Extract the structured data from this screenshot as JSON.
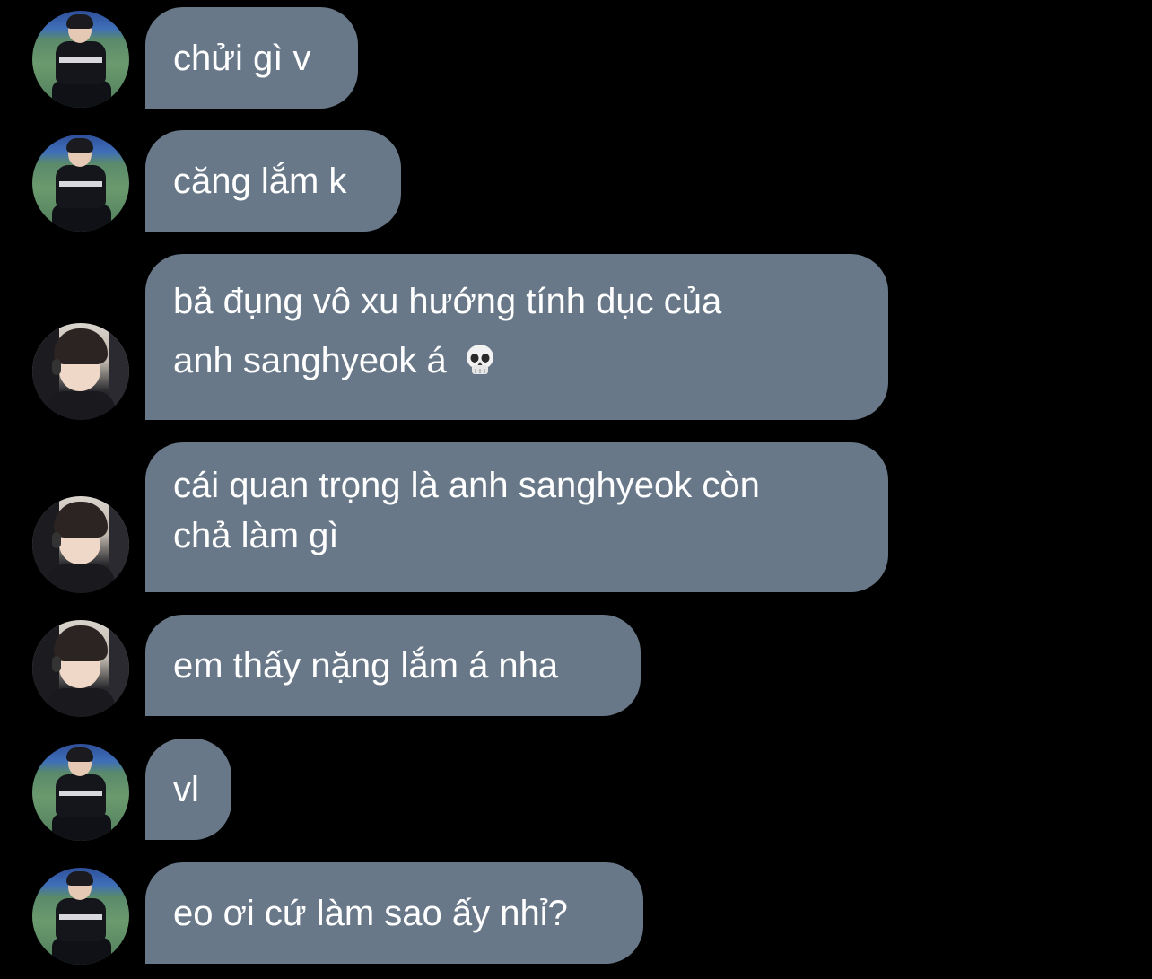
{
  "messages": [
    {
      "text": "chửi gì v",
      "avatar": "court-avatar"
    },
    {
      "text": "căng lắm k",
      "avatar": "court-avatar"
    },
    {
      "line1": "bả đụng vô xu hướng tính dục của",
      "line2": "anh sanghyeok á",
      "emoji": "skull-emoji",
      "avatar": "chair-avatar"
    },
    {
      "line1": "cái quan trọng là anh sanghyeok còn",
      "line2": "chả làm gì",
      "avatar": "chair-avatar"
    },
    {
      "text": "em thấy nặng lắm á nha",
      "avatar": "chair-avatar"
    },
    {
      "text": "vl",
      "avatar": "court-avatar"
    },
    {
      "text": "eo ơi cứ làm sao ấy nhỉ?",
      "avatar": "court-avatar"
    }
  ],
  "colors": {
    "background": "#000000",
    "bubble": "#687888",
    "text": "#ffffff"
  }
}
